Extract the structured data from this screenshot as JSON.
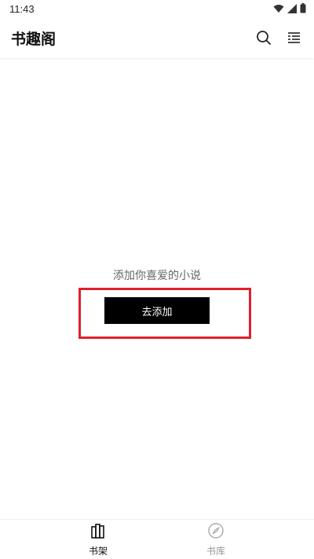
{
  "status_bar": {
    "time": "11:43"
  },
  "app_bar": {
    "title": "书趣阁",
    "search_icon": "search-icon",
    "menu_icon": "menu-icon"
  },
  "empty_state": {
    "message": "添加你喜爱的小说",
    "button_label": "去添加"
  },
  "bottom_nav": {
    "items": [
      {
        "label": "书架",
        "icon": "bookshelf-icon",
        "active": true
      },
      {
        "label": "书库",
        "icon": "compass-icon",
        "active": false
      }
    ]
  },
  "colors": {
    "highlight_border": "#e0202a",
    "button_bg": "#000000",
    "active_nav": "#111111",
    "inactive_nav": "#999999"
  }
}
